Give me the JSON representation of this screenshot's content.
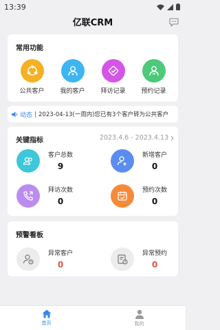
{
  "status_bar": {
    "time": "13:39"
  },
  "header": {
    "title": "亿联CRM",
    "message_icon": "message-icon"
  },
  "common_functions": {
    "title": "常用功能",
    "items": [
      {
        "label": "公共客户",
        "icon": "public-customer-icon",
        "color": "#f6b021"
      },
      {
        "label": "我的客户",
        "icon": "my-customer-icon",
        "color": "#3db5f0"
      },
      {
        "label": "拜访记录",
        "icon": "visit-record-icon",
        "color": "#d456e6"
      },
      {
        "label": "预约记录",
        "icon": "appointment-record-icon",
        "color": "#4cc97a"
      }
    ]
  },
  "news": {
    "tag": "动态",
    "text": "2023-04-13(一周内)您已有3个客户转为公共客户"
  },
  "key_metrics": {
    "title": "关键指标",
    "date_range": "2023.4.6 - 2023.4.13",
    "items": [
      {
        "label": "客户总数",
        "value": "9",
        "icon": "customers-icon",
        "color": "#3dc7d9"
      },
      {
        "label": "新增客户",
        "value": "0",
        "icon": "add-customer-icon",
        "color": "#5b8df0"
      },
      {
        "label": "拜访次数",
        "value": "0",
        "icon": "visit-call-icon",
        "color": "#bb8cf0"
      },
      {
        "label": "预约次数",
        "value": "0",
        "icon": "appointment-calendar-icon",
        "color": "#f58a3a"
      }
    ]
  },
  "warning_board": {
    "title": "预警看板",
    "items": [
      {
        "label": "异常客户",
        "value": "0",
        "icon": "abnormal-customer-icon"
      },
      {
        "label": "异常预约",
        "value": "0",
        "icon": "abnormal-appointment-icon"
      }
    ]
  },
  "tab_bar": {
    "items": [
      {
        "label": "首页",
        "icon": "home-icon",
        "active": true
      },
      {
        "label": "我的",
        "icon": "profile-icon",
        "active": false
      }
    ]
  },
  "colors": {
    "accent": "#3a86e8",
    "warning_value": "#e0553a"
  }
}
